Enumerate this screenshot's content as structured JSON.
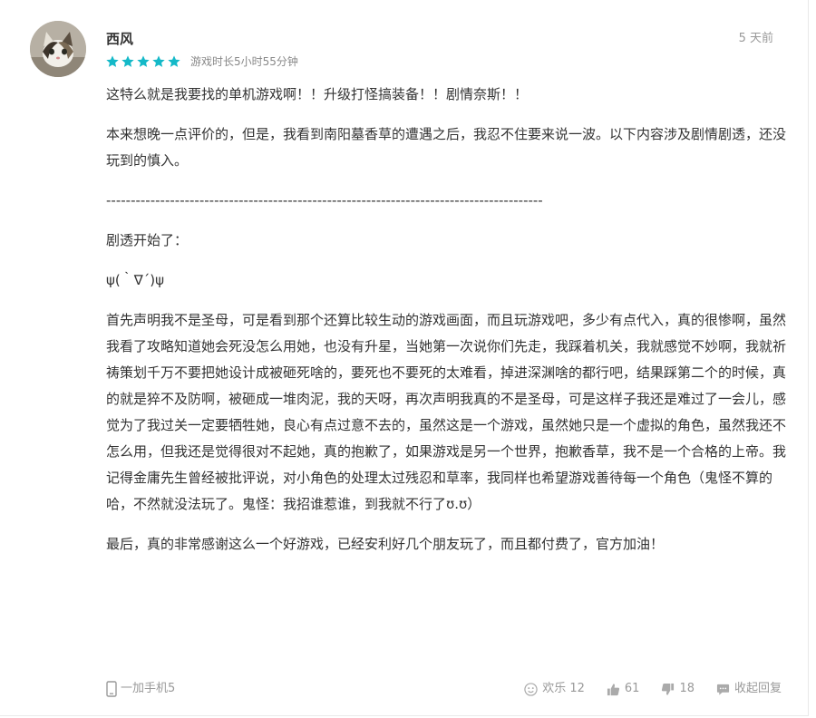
{
  "review": {
    "username": "西风",
    "rating": 5,
    "playtime": "游戏时长5小时55分钟",
    "timestamp": "5 天前",
    "paragraphs": [
      "这特么就是我要找的单机游戏啊！！升级打怪搞装备！！剧情奈斯！！",
      "本来想晚一点评价的，但是，我看到南阳墓香草的遭遇之后，我忍不住要来说一波。以下内容涉及剧情剧透，还没玩到的慎入。",
      "-----------------------------------------------------------------------------------------",
      "剧透开始了：",
      "ψ(｀∇´)ψ",
      "首先声明我不是圣母，可是看到那个还算比较生动的游戏画面，而且玩游戏吧，多少有点代入，真的很惨啊，虽然我看了攻略知道她会死没怎么用她，也没有升星，当她第一次说你们先走，我踩着机关，我就感觉不妙啊，我就祈祷策划千万不要把她设计成被砸死啥的，要死也不要死的太难看，掉进深渊啥的都行吧，结果踩第二个的时候，真的就是猝不及防啊，被砸成一堆肉泥，我的天呀，再次声明我真的不是圣母，可是这样子我还是难过了一会儿，感觉为了我过关一定要牺牲她，良心有点过意不去的，虽然这是一个游戏，虽然她只是一个虚拟的角色，虽然我还不怎么用，但我还是觉得很对不起她，真的抱歉了，如果游戏是另一个世界，抱歉香草，我不是一个合格的上帝。我记得金庸先生曾经被批评说，对小角色的处理太过残忍和草率，我同样也希望游戏善待每一个角色（鬼怪不算的哈，不然就没法玩了。鬼怪：我招谁惹谁，到我就不行了ʊ.ʊ）",
      "最后，真的非常感谢这么一个好游戏，已经安利好几个朋友玩了，而且都付费了，官方加油！"
    ],
    "device": "一加手机5",
    "actions": {
      "funny_label": "欢乐 12",
      "like_count": "61",
      "dislike_count": "18",
      "collapse_label": "收起回复"
    }
  },
  "colors": {
    "star": "#14b9c8",
    "text": "#333333",
    "muted": "#999999"
  }
}
